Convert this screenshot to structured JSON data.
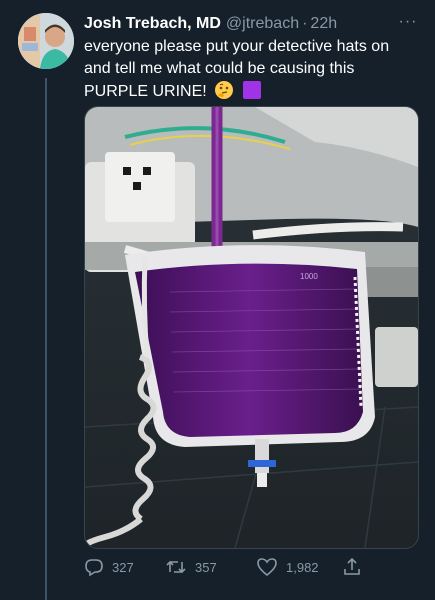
{
  "tweet": {
    "author_name": "Josh Trebach, MD",
    "handle": "@jtrebach",
    "separator": "·",
    "time": "22h",
    "more_label": "···",
    "text": "everyone please put your detective hats on and tell me what could be causing this PURPLE URINE!",
    "emojis": [
      "thinking-face-emoji",
      "purple-square-emoji"
    ]
  },
  "media": {
    "bag_label": "1000"
  },
  "actions": {
    "replies": "327",
    "retweets": "357",
    "likes": "1,982"
  },
  "colors": {
    "background": "#15202b",
    "secondary_text": "#8899a6",
    "urine_purple": "#5a1a7a"
  }
}
